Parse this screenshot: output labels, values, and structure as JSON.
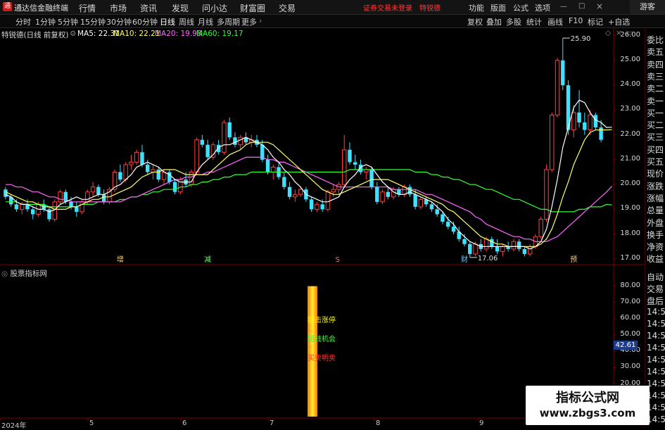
{
  "app": {
    "title": "通达信金融终端"
  },
  "menu": [
    "行情",
    "市场",
    "资讯",
    "发现",
    "问小达",
    "财富圈",
    "交易"
  ],
  "notice": {
    "status": "证券交易未登录",
    "stock": "特锐德"
  },
  "right_menu": [
    "功能",
    "版面",
    "公式",
    "选项"
  ],
  "guest": "游客",
  "periods": [
    "分时",
    "1分钟",
    "5分钟",
    "15分钟",
    "30分钟",
    "60分钟",
    "日线",
    "周线",
    "月线",
    "多周期",
    "更多"
  ],
  "active_period": "日线",
  "toolbar_right": [
    "复权",
    "叠加",
    "多股",
    "统计",
    "画线",
    "F10",
    "标记",
    "+自选"
  ],
  "legend": {
    "name": "特锐德(日线 前复权)",
    "ma5": "MA5: 22.31",
    "ma10": "MA10: 22.21",
    "ma20": "MA20: 19.93",
    "ma60": "MA60: 19.17",
    "colors": {
      "ma5": "#ffffff",
      "ma10": "#ffff66",
      "ma20": "#ff66ff",
      "ma60": "#33ff33"
    }
  },
  "right_panel": {
    "top_items": [
      "委比",
      "卖五",
      "卖四",
      "卖三",
      "卖二",
      "卖一",
      "买一",
      "买二",
      "买三",
      "买四",
      "买五",
      "现价",
      "涨跌",
      "涨幅",
      "总量",
      "外盘",
      "换手",
      "净资",
      "收益"
    ],
    "bottom_items": [
      "自动",
      "交易",
      "盘后",
      "14:5",
      "14:5",
      "14:5",
      "14:5",
      "14:5",
      "14:5",
      "14:5",
      "14:5",
      "14:5",
      "14:5"
    ]
  },
  "price_axis": [
    "26.00",
    "25.00",
    "24.00",
    "23.00",
    "22.00",
    "21.00",
    "20.00",
    "19.00",
    "18.00",
    "17.00"
  ],
  "price_annotations": {
    "high": "25.90",
    "low": "17.06"
  },
  "event_markers": [
    {
      "label": "增",
      "color": "#ffcc66"
    },
    {
      "label": "减",
      "color": "#66ff66"
    },
    {
      "label": "S",
      "color": "#ff6666"
    },
    {
      "label": "财",
      "color": "#66ccff"
    },
    {
      "label": "预",
      "color": "#ffcc66"
    }
  ],
  "indicator": {
    "title": "股票指标网",
    "axis": [
      "80.00",
      "70.00",
      "60.00",
      "50.00",
      "40.00",
      "30.00",
      "20.00",
      "10.00"
    ],
    "current": "42.61",
    "signals": [
      {
        "label": "狙击涨停",
        "color": "#ffff00"
      },
      {
        "label": "短线机会",
        "color": "#33ff33"
      },
      {
        "label": "买卖明卖",
        "color": "#ff3333"
      }
    ]
  },
  "x_axis": [
    "2024年",
    "5",
    "6",
    "7",
    "8",
    "9"
  ],
  "watermark": {
    "line1": "指标公式网",
    "line2": "www.zbgs3.com"
  },
  "chart_data": {
    "type": "candlestick",
    "ylim": [
      16.8,
      26.3
    ],
    "ohlc": [
      [
        19.8,
        19.9,
        19.4,
        19.5
      ],
      [
        19.5,
        19.6,
        19.1,
        19.2
      ],
      [
        19.2,
        19.4,
        18.9,
        19.0
      ],
      [
        19.0,
        19.3,
        18.8,
        19.2
      ],
      [
        19.2,
        19.4,
        18.9,
        19.0
      ],
      [
        19.0,
        19.1,
        18.6,
        18.8
      ],
      [
        18.8,
        19.3,
        18.7,
        19.2
      ],
      [
        19.2,
        19.4,
        18.9,
        19.0
      ],
      [
        19.0,
        19.1,
        18.5,
        18.6
      ],
      [
        18.6,
        19.4,
        18.5,
        19.3
      ],
      [
        19.3,
        19.8,
        19.2,
        19.7
      ],
      [
        19.7,
        19.8,
        19.2,
        19.3
      ],
      [
        19.3,
        19.5,
        19.0,
        19.1
      ],
      [
        19.1,
        19.3,
        18.7,
        18.9
      ],
      [
        18.9,
        19.4,
        18.8,
        19.3
      ],
      [
        19.3,
        19.8,
        19.2,
        19.7
      ],
      [
        19.7,
        20.1,
        19.5,
        19.9
      ],
      [
        19.9,
        20.0,
        19.5,
        19.6
      ],
      [
        19.6,
        19.8,
        19.2,
        19.3
      ],
      [
        19.3,
        19.9,
        19.2,
        19.8
      ],
      [
        19.8,
        20.6,
        19.7,
        20.5
      ],
      [
        20.5,
        20.8,
        20.1,
        20.2
      ],
      [
        20.2,
        20.9,
        20.1,
        20.8
      ],
      [
        20.8,
        21.2,
        20.6,
        20.9
      ],
      [
        20.9,
        21.4,
        20.8,
        21.3
      ],
      [
        21.3,
        21.6,
        20.7,
        20.8
      ],
      [
        20.8,
        21.0,
        20.4,
        20.5
      ],
      [
        20.5,
        20.8,
        20.2,
        20.6
      ],
      [
        20.6,
        20.7,
        20.1,
        20.2
      ],
      [
        20.2,
        20.6,
        20.0,
        20.5
      ],
      [
        20.5,
        20.6,
        20.0,
        20.1
      ],
      [
        20.1,
        20.2,
        19.6,
        19.7
      ],
      [
        19.7,
        20.3,
        19.6,
        20.2
      ],
      [
        20.2,
        20.5,
        19.9,
        20.0
      ],
      [
        20.0,
        20.6,
        19.9,
        20.5
      ],
      [
        20.5,
        21.9,
        20.4,
        21.8
      ],
      [
        21.8,
        22.0,
        21.5,
        21.6
      ],
      [
        21.6,
        21.8,
        21.0,
        21.1
      ],
      [
        21.1,
        21.7,
        21.0,
        21.6
      ],
      [
        21.6,
        21.8,
        21.2,
        21.3
      ],
      [
        21.3,
        22.6,
        21.2,
        22.5
      ],
      [
        22.5,
        22.7,
        21.8,
        21.9
      ],
      [
        21.9,
        22.1,
        21.5,
        21.6
      ],
      [
        21.6,
        22.0,
        21.4,
        21.9
      ],
      [
        21.9,
        22.1,
        21.6,
        21.7
      ],
      [
        21.7,
        22.0,
        21.5,
        21.8
      ],
      [
        21.8,
        22.0,
        21.5,
        21.6
      ],
      [
        21.6,
        21.8,
        20.9,
        21.0
      ],
      [
        21.0,
        21.2,
        20.4,
        20.5
      ],
      [
        20.5,
        20.8,
        20.2,
        20.7
      ],
      [
        20.7,
        20.9,
        20.2,
        20.3
      ],
      [
        20.3,
        20.5,
        19.8,
        19.9
      ],
      [
        19.9,
        20.1,
        19.4,
        19.5
      ],
      [
        19.5,
        19.8,
        19.3,
        19.6
      ],
      [
        19.6,
        19.9,
        19.5,
        19.8
      ],
      [
        19.8,
        19.9,
        19.3,
        19.4
      ],
      [
        19.4,
        19.5,
        18.9,
        19.0
      ],
      [
        19.0,
        19.3,
        18.9,
        19.2
      ],
      [
        19.2,
        19.4,
        18.9,
        19.0
      ],
      [
        19.0,
        19.8,
        18.9,
        19.7
      ],
      [
        19.7,
        20.0,
        19.5,
        19.8
      ],
      [
        19.8,
        20.1,
        19.6,
        20.0
      ],
      [
        20.0,
        22.0,
        19.9,
        21.4
      ],
      [
        21.4,
        21.7,
        20.8,
        20.9
      ],
      [
        20.9,
        21.2,
        20.6,
        20.8
      ],
      [
        20.8,
        21.0,
        20.4,
        20.5
      ],
      [
        20.5,
        20.7,
        20.2,
        20.6
      ],
      [
        20.6,
        20.7,
        19.8,
        19.9
      ],
      [
        19.9,
        20.1,
        19.2,
        19.3
      ],
      [
        19.3,
        19.8,
        19.2,
        19.7
      ],
      [
        19.7,
        19.9,
        19.4,
        19.5
      ],
      [
        19.5,
        19.9,
        19.4,
        19.8
      ],
      [
        19.8,
        19.9,
        19.5,
        19.6
      ],
      [
        19.6,
        20.0,
        19.5,
        19.9
      ],
      [
        19.9,
        20.0,
        19.5,
        19.6
      ],
      [
        19.6,
        19.8,
        19.0,
        19.1
      ],
      [
        19.1,
        19.5,
        19.0,
        19.4
      ],
      [
        19.4,
        19.5,
        19.1,
        19.2
      ],
      [
        19.2,
        19.3,
        18.9,
        19.0
      ],
      [
        19.0,
        19.2,
        18.7,
        18.8
      ],
      [
        18.8,
        18.9,
        18.4,
        18.5
      ],
      [
        18.5,
        18.7,
        18.2,
        18.3
      ],
      [
        18.3,
        18.5,
        18.0,
        18.1
      ],
      [
        18.1,
        18.3,
        17.7,
        17.8
      ],
      [
        17.8,
        18.0,
        17.5,
        17.6
      ],
      [
        17.6,
        17.7,
        17.06,
        17.2
      ],
      [
        17.2,
        17.7,
        17.1,
        17.6
      ],
      [
        17.6,
        17.8,
        17.3,
        17.4
      ],
      [
        17.4,
        17.9,
        17.3,
        17.8
      ],
      [
        17.8,
        17.9,
        17.4,
        17.5
      ],
      [
        17.5,
        17.8,
        17.2,
        17.3
      ],
      [
        17.3,
        17.6,
        17.1,
        17.5
      ],
      [
        17.5,
        17.7,
        17.3,
        17.4
      ],
      [
        17.4,
        17.8,
        17.3,
        17.7
      ],
      [
        17.7,
        17.8,
        17.3,
        17.4
      ],
      [
        17.4,
        17.5,
        17.1,
        17.2
      ],
      [
        17.2,
        17.6,
        17.1,
        17.5
      ],
      [
        17.5,
        18.0,
        17.4,
        17.9
      ],
      [
        17.9,
        18.7,
        17.8,
        18.6
      ],
      [
        18.6,
        20.8,
        18.5,
        20.6
      ],
      [
        20.6,
        22.9,
        20.5,
        22.8
      ],
      [
        22.8,
        25.1,
        22.7,
        25.0
      ],
      [
        25.0,
        25.9,
        23.8,
        24.0
      ],
      [
        24.0,
        24.2,
        22.0,
        22.2
      ],
      [
        22.2,
        23.2,
        21.9,
        22.9
      ],
      [
        22.9,
        23.8,
        22.3,
        22.5
      ],
      [
        22.5,
        22.9,
        22.0,
        22.2
      ],
      [
        22.2,
        23.0,
        22.0,
        22.8
      ],
      [
        22.8,
        22.9,
        22.2,
        22.3
      ],
      [
        22.3,
        22.6,
        21.7,
        21.8
      ]
    ],
    "ma5": [
      19.6,
      19.5,
      19.3,
      19.2,
      19.2,
      19.1,
      19.0,
      19.0,
      18.9,
      18.98,
      19.2,
      19.3,
      19.4,
      19.5,
      19.4,
      19.4,
      19.5,
      19.6,
      19.6,
      19.7,
      19.9,
      20.0,
      20.2,
      20.4,
      20.7,
      20.8,
      20.9,
      20.8,
      20.7,
      20.5,
      20.4,
      20.2,
      20.1,
      20.1,
      20.1,
      20.5,
      20.8,
      21.0,
      21.2,
      21.5,
      21.6,
      21.6,
      21.7,
      21.8,
      21.9,
      21.8,
      21.7,
      21.6,
      21.4,
      21.1,
      20.9,
      20.6,
      20.4,
      20.1,
      19.9,
      19.6,
      19.5,
      19.4,
      19.3,
      19.3,
      19.4,
      19.5,
      19.9,
      20.2,
      20.4,
      20.7,
      20.8,
      20.7,
      20.4,
      20.1,
      19.9,
      19.7,
      19.6,
      19.6,
      19.7,
      19.6,
      19.5,
      19.4,
      19.3,
      19.1,
      18.9,
      18.6,
      18.4,
      18.1,
      17.9,
      17.7,
      17.6,
      17.5,
      17.5,
      17.5,
      17.5,
      17.5,
      17.5,
      17.5,
      17.5,
      17.5,
      17.4,
      17.5,
      17.7,
      18.2,
      19.1,
      20.2,
      21.5,
      22.3,
      23.1,
      23.4,
      23.3,
      22.9,
      22.6,
      22.5,
      22.3,
      22.31
    ],
    "ma10": [
      19.7,
      19.6,
      19.5,
      19.4,
      19.3,
      19.3,
      19.2,
      19.1,
      19.1,
      19.0,
      19.0,
      19.0,
      19.1,
      19.1,
      19.2,
      19.3,
      19.4,
      19.4,
      19.5,
      19.5,
      19.6,
      19.7,
      19.8,
      19.9,
      20.1,
      20.3,
      20.4,
      20.5,
      20.5,
      20.6,
      20.6,
      20.6,
      20.5,
      20.4,
      20.4,
      20.4,
      20.4,
      20.4,
      20.6,
      20.8,
      21.0,
      21.2,
      21.3,
      21.4,
      21.6,
      21.7,
      21.7,
      21.7,
      21.7,
      21.6,
      21.4,
      21.2,
      21.0,
      20.8,
      20.6,
      20.4,
      20.2,
      20.0,
      19.8,
      19.7,
      19.6,
      19.6,
      19.7,
      19.8,
      19.9,
      20.0,
      20.1,
      20.2,
      20.2,
      20.2,
      20.2,
      20.1,
      20.0,
      19.9,
      19.8,
      19.7,
      19.6,
      19.5,
      19.4,
      19.3,
      19.2,
      19.0,
      18.9,
      18.7,
      18.5,
      18.3,
      18.1,
      17.9,
      17.8,
      17.7,
      17.6,
      17.6,
      17.5,
      17.5,
      17.5,
      17.5,
      17.5,
      17.5,
      17.6,
      17.8,
      18.2,
      18.8,
      19.5,
      20.1,
      20.8,
      21.3,
      21.8,
      22.1,
      22.2,
      22.2,
      22.2,
      22.21
    ],
    "ma20": [
      20.0,
      20.0,
      19.9,
      19.9,
      19.8,
      19.7,
      19.7,
      19.6,
      19.5,
      19.5,
      19.4,
      19.4,
      19.3,
      19.3,
      19.3,
      19.3,
      19.3,
      19.3,
      19.3,
      19.3,
      19.3,
      19.3,
      19.4,
      19.5,
      19.5,
      19.6,
      19.7,
      19.8,
      19.9,
      20.0,
      20.1,
      20.2,
      20.2,
      20.3,
      20.3,
      20.4,
      20.4,
      20.5,
      20.5,
      20.6,
      20.7,
      20.8,
      20.9,
      21.0,
      21.1,
      21.1,
      21.1,
      21.1,
      21.0,
      21.0,
      20.9,
      20.9,
      20.8,
      20.7,
      20.6,
      20.5,
      20.4,
      20.3,
      20.2,
      20.1,
      20.0,
      19.9,
      19.9,
      19.9,
      19.9,
      19.9,
      19.9,
      19.9,
      19.9,
      19.9,
      19.9,
      19.8,
      19.8,
      19.8,
      19.8,
      19.8,
      19.7,
      19.6,
      19.6,
      19.5,
      19.4,
      19.3,
      19.2,
      19.1,
      19.0,
      18.9,
      18.7,
      18.6,
      18.4,
      18.3,
      18.2,
      18.1,
      18.0,
      17.9,
      17.9,
      17.8,
      17.8,
      17.7,
      17.7,
      17.7,
      17.8,
      17.9,
      18.1,
      18.3,
      18.5,
      18.7,
      18.9,
      19.1,
      19.3,
      19.5,
      19.7,
      19.93
    ],
    "ma60": [
      19.3,
      19.3,
      19.3,
      19.2,
      19.2,
      19.2,
      19.2,
      19.2,
      19.1,
      19.1,
      19.1,
      19.1,
      19.1,
      19.1,
      19.2,
      19.2,
      19.2,
      19.3,
      19.3,
      19.3,
      19.3,
      19.4,
      19.4,
      19.5,
      19.5,
      19.6,
      19.6,
      19.7,
      19.7,
      19.8,
      19.8,
      19.8,
      19.9,
      19.9,
      20.0,
      20.0,
      20.1,
      20.1,
      20.2,
      20.2,
      20.3,
      20.3,
      20.4,
      20.4,
      20.4,
      20.5,
      20.5,
      20.5,
      20.5,
      20.5,
      20.5,
      20.5,
      20.5,
      20.5,
      20.5,
      20.5,
      20.5,
      20.5,
      20.5,
      20.5,
      20.5,
      20.5,
      20.5,
      20.6,
      20.6,
      20.6,
      20.6,
      20.6,
      20.6,
      20.6,
      20.6,
      20.6,
      20.6,
      20.6,
      20.6,
      20.5,
      20.5,
      20.5,
      20.4,
      20.4,
      20.3,
      20.3,
      20.2,
      20.2,
      20.1,
      20.0,
      20.0,
      19.9,
      19.8,
      19.8,
      19.7,
      19.6,
      19.5,
      19.4,
      19.4,
      19.3,
      19.2,
      19.1,
      19.0,
      19.0,
      18.9,
      18.9,
      18.9,
      18.9,
      18.9,
      19.0,
      19.0,
      19.1,
      19.1,
      19.1,
      19.2,
      19.17
    ],
    "indicator_ylim": [
      0,
      85
    ],
    "indicator_bar": {
      "value": 80
    }
  }
}
